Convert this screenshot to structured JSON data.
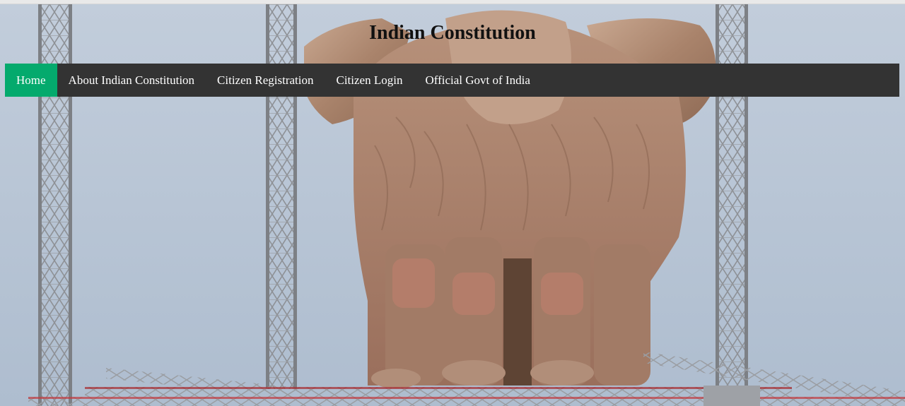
{
  "header": {
    "title": "Indian Constitution"
  },
  "nav": {
    "items": [
      {
        "label": "Home",
        "active": true
      },
      {
        "label": "About Indian Constitution",
        "active": false
      },
      {
        "label": "Citizen Registration",
        "active": false
      },
      {
        "label": "Citizen Login",
        "active": false
      },
      {
        "label": "Official Govt of India",
        "active": false
      }
    ]
  },
  "colors": {
    "nav_background": "#333333",
    "nav_active": "#04aa6d",
    "nav_text": "#ffffff",
    "sky": "#b5c3d4",
    "sculpture": "#b08c75"
  },
  "hero": {
    "subject": "lion-capital-emblem-image"
  }
}
